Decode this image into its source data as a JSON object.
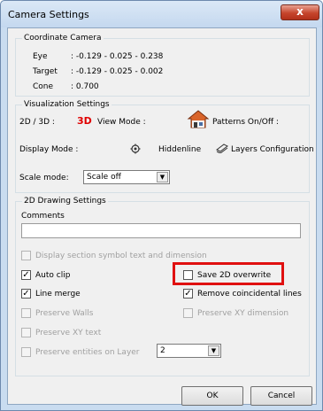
{
  "window": {
    "title": "Camera Settings",
    "close_label": "x"
  },
  "coordinate_camera": {
    "legend": "Coordinate Camera",
    "rows": [
      {
        "label": "Eye",
        "value": ": -0.129 - 0.025 - 0.238"
      },
      {
        "label": "Target",
        "value": ": -0.129 - 0.025 - 0.002"
      },
      {
        "label": "Cone",
        "value": ": 0.700"
      }
    ]
  },
  "visualization": {
    "legend": "Visualization Settings",
    "dim_label": "2D / 3D :",
    "dim_value": "3D",
    "view_mode_label": "View Mode :",
    "patterns_label": "Patterns On/Off :",
    "display_mode_label": "Display Mode :",
    "hiddenline_label": "Hiddenline",
    "layers_label": "Layers Configuration",
    "scale_mode_label": "Scale mode:",
    "scale_mode_value": "Scale off",
    "accent_color": "#e00000"
  },
  "drawing": {
    "legend": "2D Drawing Settings",
    "comments_label": "Comments",
    "comments_value": "",
    "display_section_label": "Display section symbol text and dimension",
    "auto_clip_label": "Auto clip",
    "auto_clip_checked": true,
    "save_2d_label": "Save 2D overwrite",
    "save_2d_checked": false,
    "line_merge_label": "Line merge",
    "line_merge_checked": true,
    "remove_coincidental_label": "Remove coincidental lines",
    "remove_coincidental_checked": true,
    "preserve_walls_label": "Preserve Walls",
    "preserve_xy_dimension_label": "Preserve XY dimension",
    "preserve_xy_text_label": "Preserve XY text",
    "preserve_entities_label": "Preserve entities on Layer",
    "layer_value": "2",
    "highlight_color": "#e01010"
  },
  "buttons": {
    "ok": "OK",
    "cancel": "Cancel"
  },
  "icons": {
    "close": "close-icon",
    "house": "house-icon",
    "gear": "gear-icon",
    "layers": "layers-icon",
    "dropdown": "chevron-down-icon"
  }
}
